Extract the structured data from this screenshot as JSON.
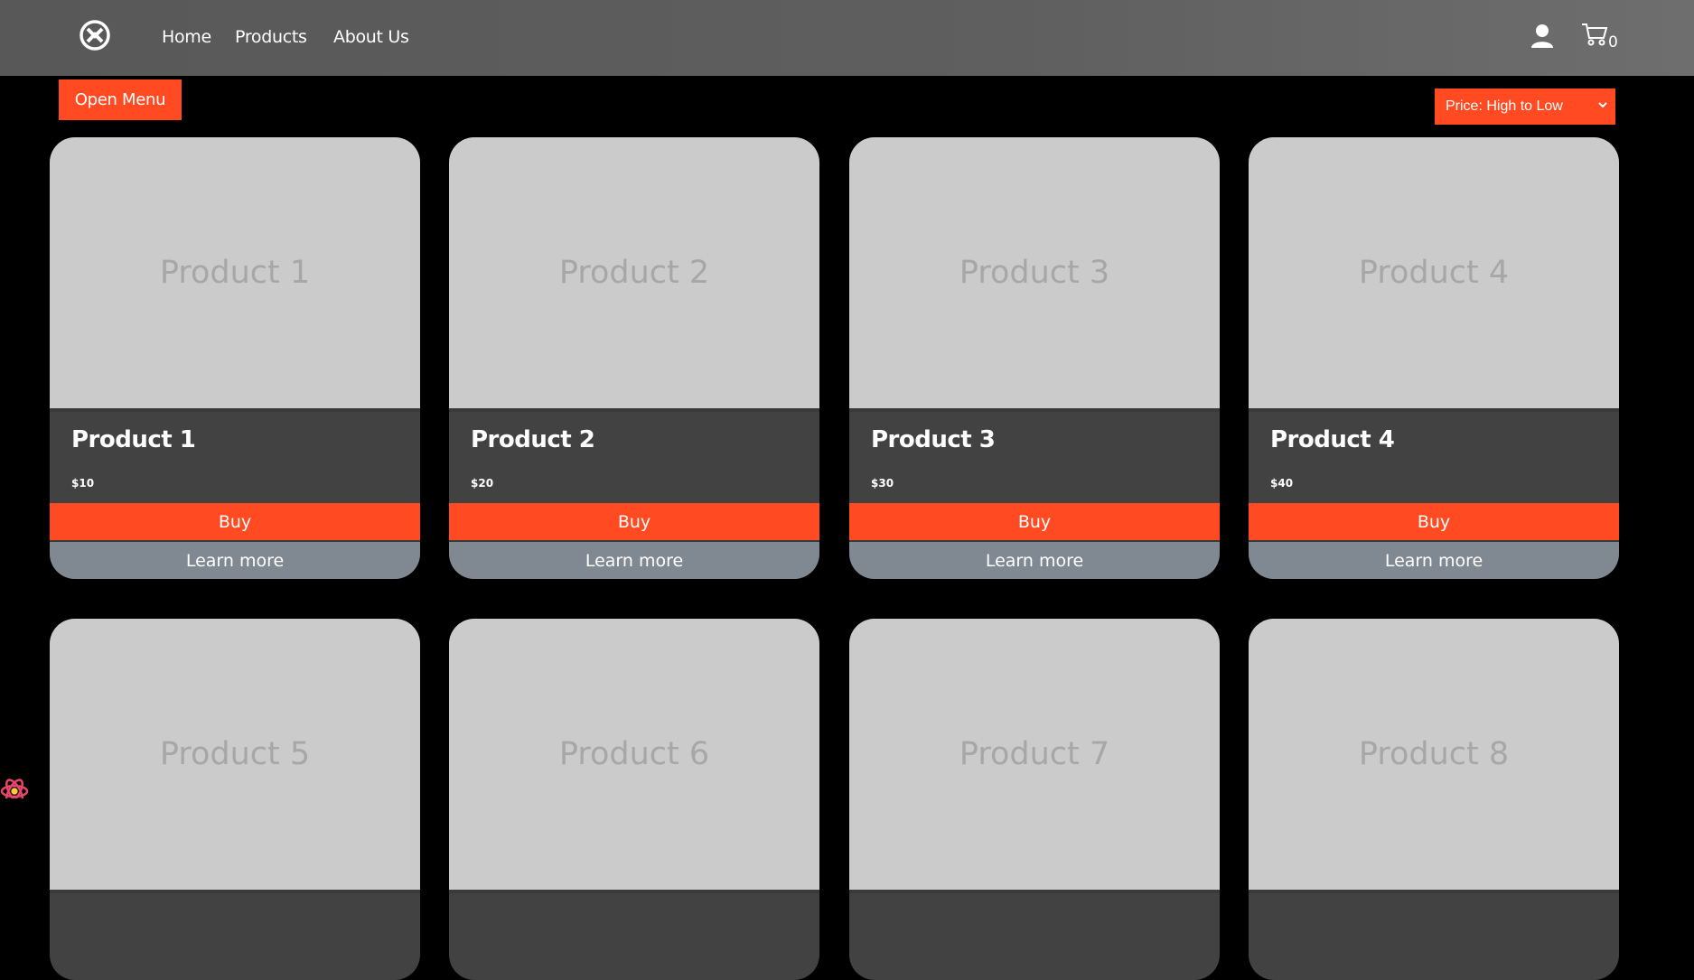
{
  "nav": {
    "links": [
      "Home",
      "Products",
      "About Us"
    ],
    "cart_count": "0"
  },
  "toolbar": {
    "open_menu_label": "Open Menu",
    "sort_selected": "Price: High to Low"
  },
  "products": [
    {
      "placeholder": "Product 1",
      "name": "Product 1",
      "price": "$10",
      "buy_label": "Buy",
      "learn_label": "Learn more"
    },
    {
      "placeholder": "Product 2",
      "name": "Product 2",
      "price": "$20",
      "buy_label": "Buy",
      "learn_label": "Learn more"
    },
    {
      "placeholder": "Product 3",
      "name": "Product 3",
      "price": "$30",
      "buy_label": "Buy",
      "learn_label": "Learn more"
    },
    {
      "placeholder": "Product 4",
      "name": "Product 4",
      "price": "$40",
      "buy_label": "Buy",
      "learn_label": "Learn more"
    },
    {
      "placeholder": "Product 5"
    },
    {
      "placeholder": "Product 6"
    },
    {
      "placeholder": "Product 7"
    },
    {
      "placeholder": "Product 8"
    }
  ],
  "colors": {
    "accent": "#ff4a22",
    "card_bg": "#424242",
    "image_bg": "#cbcbcb",
    "secondary_button": "#808891"
  },
  "icons": [
    "logo-icon",
    "user-icon",
    "cart-icon",
    "chevron-down-icon"
  ]
}
